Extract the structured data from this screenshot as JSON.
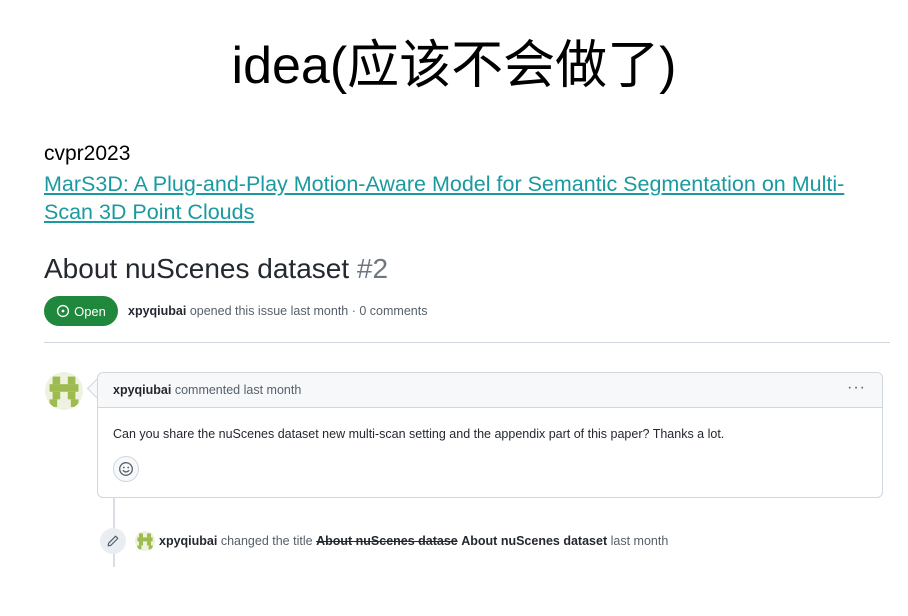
{
  "slide": {
    "title": "idea(应该不会做了)",
    "venue": "cvpr2023",
    "paper_link_text": "MarS3D: A Plug-and-Play Motion-Aware Model for Semantic Segmentation on Multi-Scan 3D Point Clouds"
  },
  "issue": {
    "title": "About nuScenes dataset",
    "number": "#2",
    "state": "Open",
    "author": "xpyqiubai",
    "meta_suffix": "opened this issue last month · 0 comments"
  },
  "comment": {
    "author": "xpyqiubai",
    "time_text": "commented last month",
    "menu_label": "···",
    "body": "Can you share the nuScenes dataset new multi-scan setting and the appendix part of this paper? Thanks a lot.",
    "reaction_icon": "smiley-icon"
  },
  "event": {
    "actor": "xpyqiubai",
    "action": "changed the title",
    "old_title": "About nuScenes datase",
    "new_title": "About nuScenes dataset",
    "time_text": "last month",
    "icon": "pencil-icon"
  },
  "colors": {
    "open_badge": "#1f883d",
    "link": "#1a9aa0",
    "avatar_fg": "#9dbb4e"
  }
}
